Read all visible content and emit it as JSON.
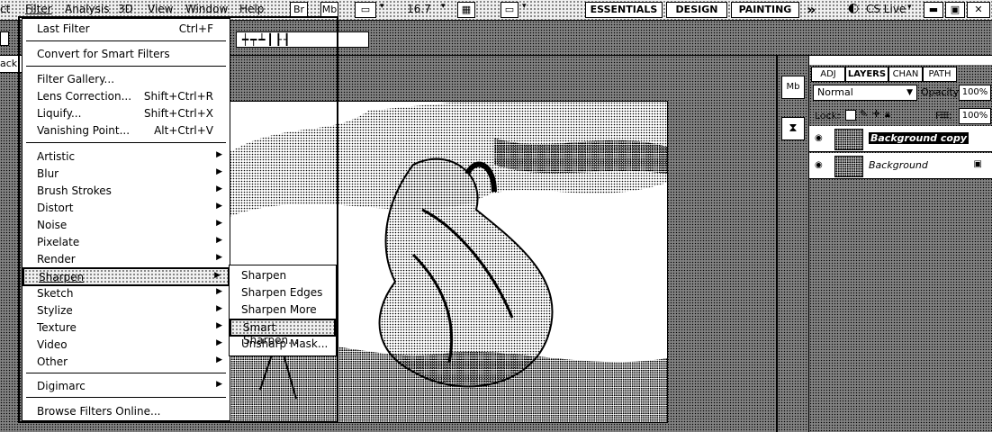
{
  "menubar": {
    "items": [
      "ct",
      "Filter",
      "Analysis",
      "3D",
      "View",
      "Window",
      "Help"
    ],
    "br_label": "Br",
    "mb_label": "Mb",
    "zoom": "16.7",
    "workspaces": [
      "ESSENTIALS",
      "DESIGN",
      "PAINTING"
    ],
    "more_label": "»",
    "cslive": "CS Live"
  },
  "doc_tab": "ack",
  "filter_menu": {
    "items": [
      {
        "label": "Last Filter",
        "shortcut": "Ctrl+F"
      },
      {
        "label": "Convert for Smart Filters"
      },
      {
        "label": "Filter Gallery..."
      },
      {
        "label": "Lens Correction...",
        "shortcut": "Shift+Ctrl+R"
      },
      {
        "label": "Liquify...",
        "shortcut": "Shift+Ctrl+X"
      },
      {
        "label": "Vanishing Point...",
        "shortcut": "Alt+Ctrl+V"
      },
      {
        "label": "Artistic"
      },
      {
        "label": "Blur"
      },
      {
        "label": "Brush Strokes"
      },
      {
        "label": "Distort"
      },
      {
        "label": "Noise"
      },
      {
        "label": "Pixelate"
      },
      {
        "label": "Render"
      },
      {
        "label": "Sharpen"
      },
      {
        "label": "Sketch"
      },
      {
        "label": "Stylize"
      },
      {
        "label": "Texture"
      },
      {
        "label": "Video"
      },
      {
        "label": "Other"
      },
      {
        "label": "Digimarc"
      },
      {
        "label": "Browse Filters Online..."
      }
    ]
  },
  "sharpen_menu": {
    "items": [
      "Sharpen",
      "Sharpen Edges",
      "Sharpen More",
      "Smart Sharpen...",
      "Unsharp Mask..."
    ]
  },
  "layers_panel": {
    "tabs": [
      "ADJ",
      "LAYERS",
      "CHAN",
      "PATH"
    ],
    "blend_mode": "Normal",
    "opacity_label": "Opacity:",
    "opacity_value": "100%",
    "lock_label": "Lock:",
    "fill_label": "Fill:",
    "fill_value": "100%",
    "layers": [
      {
        "name": "Background copy"
      },
      {
        "name": "Background"
      }
    ]
  }
}
